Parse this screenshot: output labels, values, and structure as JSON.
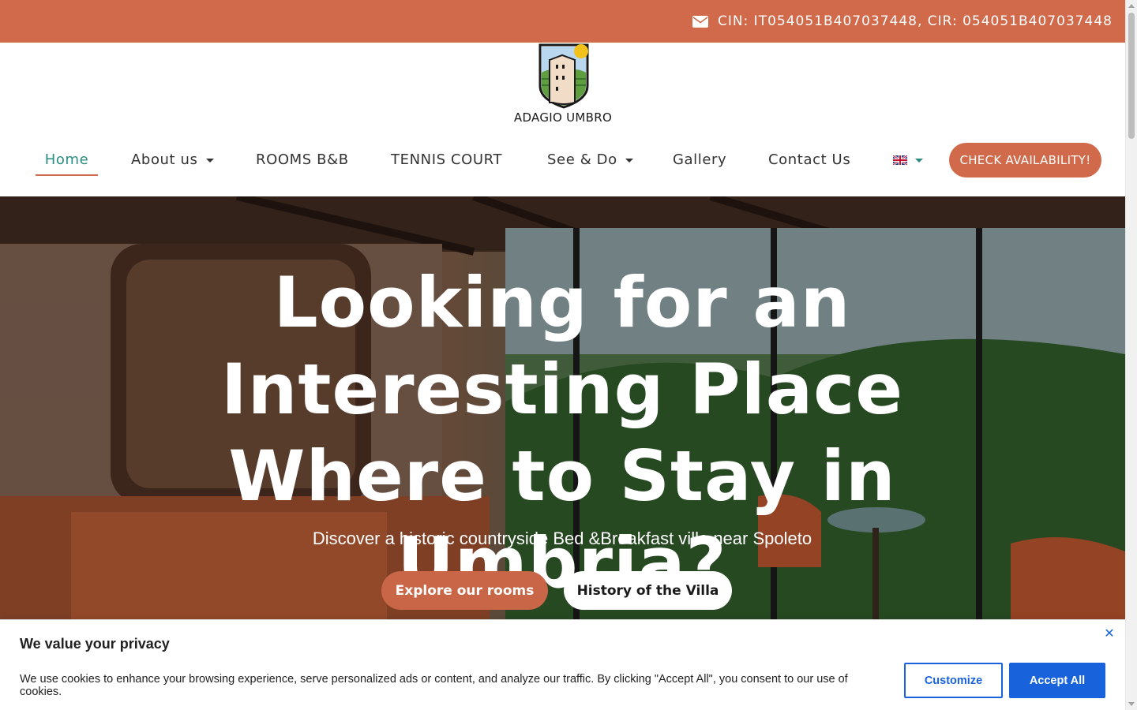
{
  "topbar": {
    "icon": "envelope-icon",
    "registration": "CIN: IT054051B407037448, CIR: 054051B407037448",
    "bg_color": "#d06a4b"
  },
  "logo": {
    "text": "ADAGIO UMBRO"
  },
  "nav": {
    "items": [
      {
        "label": "Home",
        "active": true
      },
      {
        "label": "About us",
        "dropdown": true
      },
      {
        "label": "ROOMS B&B"
      },
      {
        "label": "TENNIS COURT"
      },
      {
        "label": "See & Do",
        "dropdown": true
      },
      {
        "label": "Gallery"
      },
      {
        "label": "Contact Us"
      }
    ],
    "language_icon": "uk-flag-icon",
    "cta_label": "CHECK AVAILABILITY!",
    "active_color": "#2a8d80",
    "accent_color": "#d06a4b"
  },
  "hero": {
    "title": "Looking for an Interesting Place Where to Stay in Umbria?",
    "subtitle": "Discover a historic countryside Bed &Breakfast villa near Spoleto",
    "primary_button": "Explore our rooms",
    "secondary_button": "History of the Villa"
  },
  "cookie": {
    "title": "We value your privacy",
    "text": "We use cookies to enhance your browsing experience, serve personalized ads or content, and analyze our traffic. By clicking \"Accept All\", you consent to our use of cookies.",
    "close_icon": "close-icon",
    "customize_label": "Customize",
    "accept_label": "Accept All",
    "button_color": "#1863dc"
  }
}
